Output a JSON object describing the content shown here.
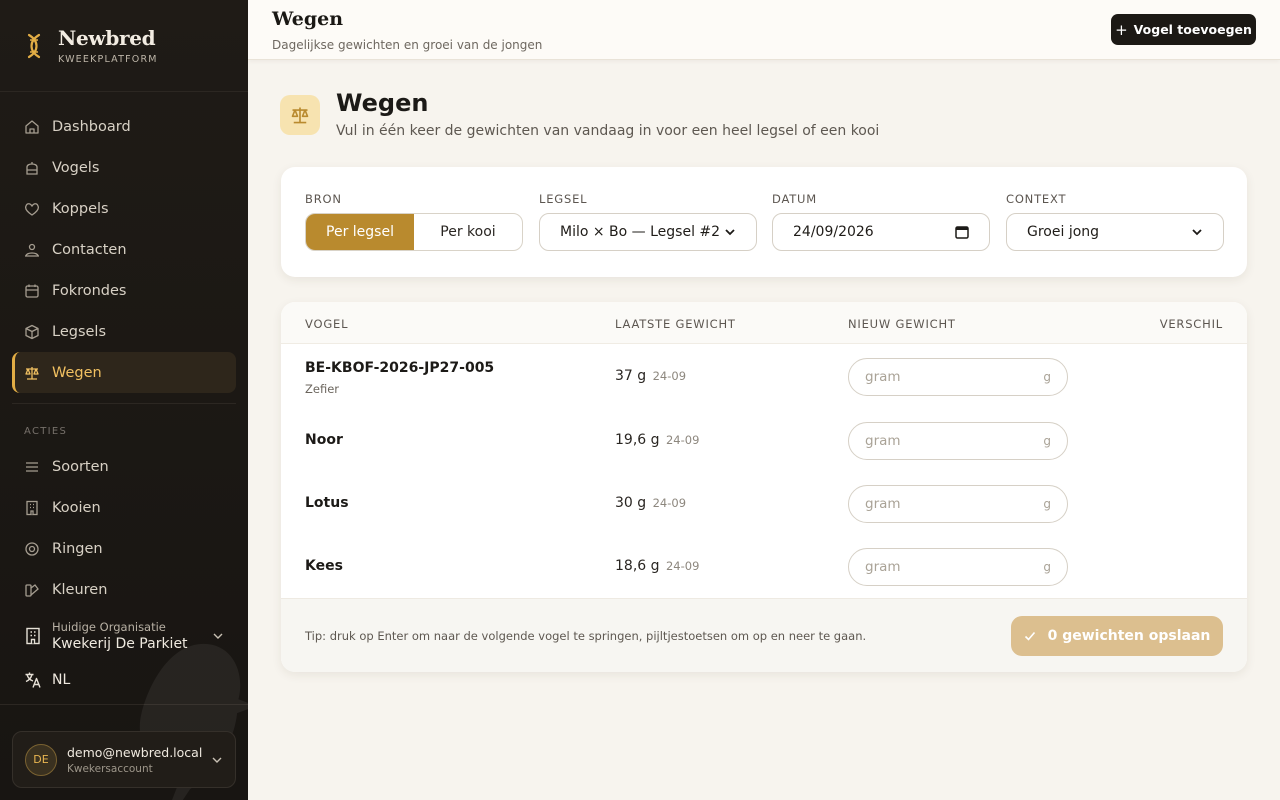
{
  "brand": {
    "name": "Newbred",
    "subtitle": "KWEEKPLATFORM"
  },
  "sidebar": {
    "items": [
      {
        "label": "Dashboard",
        "icon": "home-icon"
      },
      {
        "label": "Vogels",
        "icon": "cage-icon"
      },
      {
        "label": "Koppels",
        "icon": "heart-icon"
      },
      {
        "label": "Contacten",
        "icon": "contacts-icon"
      },
      {
        "label": "Fokrondes",
        "icon": "calendar-icon"
      },
      {
        "label": "Legsels",
        "icon": "box-icon"
      },
      {
        "label": "Wegen",
        "icon": "scale-icon",
        "active": true
      }
    ],
    "section_label": "ACTIES",
    "actions": [
      {
        "label": "Soorten",
        "icon": "list-icon"
      },
      {
        "label": "Kooien",
        "icon": "building-icon"
      },
      {
        "label": "Ringen",
        "icon": "ring-icon"
      },
      {
        "label": "Kleuren",
        "icon": "palette-icon"
      }
    ],
    "org": {
      "label": "Huidige Organisatie",
      "name": "Kwekerij De Parkiet"
    },
    "lang": "NL",
    "user": {
      "initials": "DE",
      "email": "demo@newbred.local",
      "role": "Kwekersaccount"
    }
  },
  "topbar": {
    "title": "Wegen",
    "subtitle": "Dagelijkse gewichten en groei van de jongen",
    "add_button": "Vogel toevoegen"
  },
  "page": {
    "title": "Wegen",
    "subtitle": "Vul in één keer de gewichten van vandaag in voor een heel legsel of een kooi"
  },
  "filters": {
    "bron_label": "BRON",
    "bron_options": [
      "Per legsel",
      "Per kooi"
    ],
    "legsel_label": "LEGSEL",
    "legsel_value": "Milo × Bo — Legsel #2",
    "datum_label": "DATUM",
    "datum_value": "24/09/2026",
    "context_label": "CONTEXT",
    "context_value": "Groei jong"
  },
  "table": {
    "headers": [
      "VOGEL",
      "LAATSTE GEWICHT",
      "NIEUW GEWICHT",
      "VERSCHIL"
    ],
    "rows": [
      {
        "name": "BE-KBOF-2026-JP27-005",
        "sub": "Zefier",
        "weight": "37 g",
        "date": "24-09",
        "placeholder": "gram",
        "unit": "g"
      },
      {
        "name": "Noor",
        "sub": "",
        "weight": "19,6 g",
        "date": "24-09",
        "placeholder": "gram",
        "unit": "g"
      },
      {
        "name": "Lotus",
        "sub": "",
        "weight": "30 g",
        "date": "24-09",
        "placeholder": "gram",
        "unit": "g"
      },
      {
        "name": "Kees",
        "sub": "",
        "weight": "18,6 g",
        "date": "24-09",
        "placeholder": "gram",
        "unit": "g"
      }
    ],
    "tip": "Tip: druk op Enter om naar de volgende vogel te springen, pijltjestoetsen om op en neer te gaan.",
    "save_button": "0 gewichten opslaan"
  },
  "colors": {
    "accent": "#b98a2e",
    "active_nav": "#f1c061",
    "save_disabled": "#dcbf8f"
  }
}
